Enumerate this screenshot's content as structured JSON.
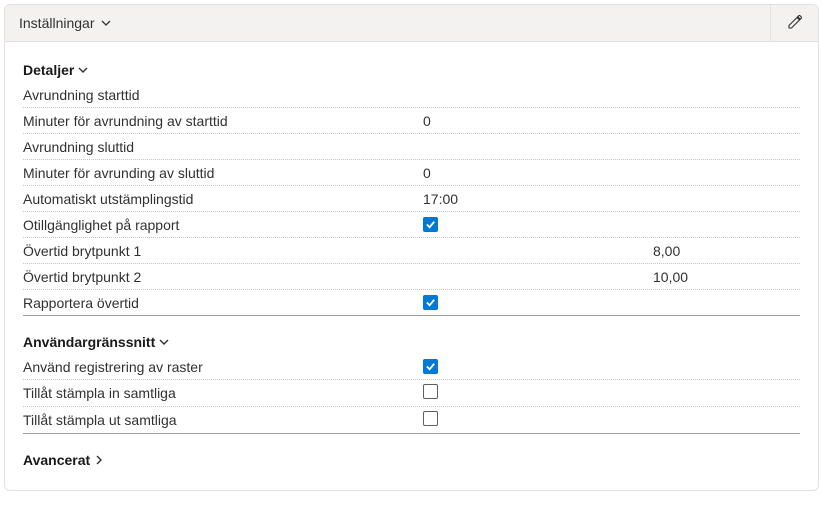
{
  "header": {
    "title": "Inställningar"
  },
  "sections": {
    "details": {
      "title": "Detaljer",
      "rows": {
        "round_start": {
          "label": "Avrundning starttid",
          "value": ""
        },
        "round_start_min": {
          "label": "Minuter för avrundning av starttid",
          "value": "0"
        },
        "round_end": {
          "label": "Avrundning sluttid",
          "value": ""
        },
        "round_end_min": {
          "label": "Minuter för avrunding av sluttid",
          "value": "0"
        },
        "auto_clockout": {
          "label": "Automatiskt utstämplingstid",
          "value": "17:00"
        },
        "unavail_report": {
          "label": "Otillgänglighet på rapport",
          "checked": true
        },
        "ot_bp1": {
          "label": "Övertid brytpunkt 1",
          "value_right": "8,00"
        },
        "ot_bp2": {
          "label": "Övertid brytpunkt 2",
          "value_right": "10,00"
        },
        "report_ot": {
          "label": "Rapportera övertid",
          "checked": true
        }
      }
    },
    "ui": {
      "title": "Användargränssnitt",
      "rows": {
        "use_raster": {
          "label": "Använd registrering av raster",
          "checked": true
        },
        "allow_in_all": {
          "label": "Tillåt stämpla in samtliga",
          "checked": false
        },
        "allow_out_all": {
          "label": "Tillåt stämpla ut samtliga",
          "checked": false
        }
      }
    },
    "advanced": {
      "title": "Avancerat"
    }
  }
}
